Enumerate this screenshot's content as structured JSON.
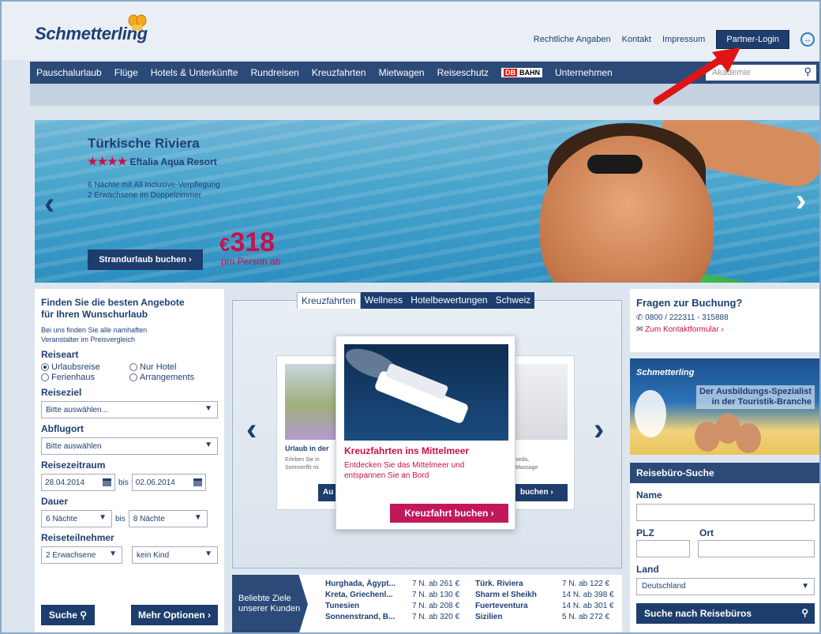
{
  "header": {
    "logo": "Schmetterling",
    "links": [
      "Rechtliche Angaben",
      "Kontakt",
      "Impressum"
    ],
    "partner_login": "Partner-Login"
  },
  "nav": {
    "items": [
      "Pauschalurlaub",
      "Flüge",
      "Hotels & Unterkünfte",
      "Rundreisen",
      "Kreuzfahrten",
      "Mietwagen",
      "Reiseschutz"
    ],
    "db_label": "DB",
    "bahn_label": "BAHN",
    "company": "Unternehmen",
    "search_placeholder": "Akademie"
  },
  "hero": {
    "title": "Türkische Riviera",
    "stars": "★★★★",
    "hotel": "Eftalia Aqua Resort",
    "desc_line1": "6 Nächte mit All Inclusive-Verpflegung",
    "desc_line2": "2 Erwachsene im Doppelzimmer",
    "button": "Strandurlaub buchen ›",
    "currency": "€",
    "price": "318",
    "per_person": "pro Person ab"
  },
  "search": {
    "title_line1": "Finden Sie die besten Angebote",
    "title_line2": "für Ihren Wunschurlaub",
    "sub_line1": "Bei uns finden Sie alle namhaften",
    "sub_line2": "Veranstalter im Preisvergleich",
    "reiseart_label": "Reiseart",
    "options": [
      "Urlaubsreise",
      "Nur Hotel",
      "Ferienhaus",
      "Arrangements"
    ],
    "reiseziel_label": "Reiseziel",
    "reiseziel_value": "Bitte auswählen...",
    "abflugort_label": "Abflugort",
    "abflugort_value": "Bitte auswählen",
    "zeitraum_label": "Reisezeitraum",
    "date_from": "28.04.2014",
    "bis": "bis",
    "date_to": "02.06.2014",
    "dauer_label": "Dauer",
    "dauer_from": "6 Nächte",
    "dauer_to": "8 Nächte",
    "teilnehmer_label": "Reiseteilnehmer",
    "adults": "2 Erwachsene",
    "kids": "kein Kind",
    "search_button": "Suche",
    "more_button": "Mehr Optionen ›"
  },
  "carousel": {
    "tabs": [
      "Kreuzfahrten",
      "Wellness",
      "Hotelbewertungen",
      "Schweiz"
    ],
    "left_card_title": "Urlaub in der",
    "left_card_desc1": "Erleben Sie in",
    "left_card_desc2": "Sommerflit mi",
    "left_card_btn": "Au",
    "right_card_desc1": "veda,",
    "right_card_desc2": "Massage",
    "right_card_btn": "buchen ›",
    "card_title": "Kreuzfahrten ins Mittelmeer",
    "card_desc": "Entdecken Sie das Mittelmeer und entspannen Sie an Bord",
    "card_button": "Kreuzfahrt buchen ›"
  },
  "destinations": {
    "head_line1": "Beliebte Ziele",
    "head_line2": "unserer Kunden",
    "rows": [
      [
        "Hurghada, Ägypt...",
        "7 N. ab 261 €",
        "Türk. Riviera",
        "7 N. ab 122 €"
      ],
      [
        "Kreta, Griechenl...",
        "7 N. ab 130 €",
        "Sharm el Sheikh",
        "14 N. ab 398 €"
      ],
      [
        "Tunesien",
        "7 N. ab 208 €",
        "Fuerteventura",
        "14 N. ab 301 €"
      ],
      [
        "Sonnenstrand, B...",
        "7 N. ab 320 €",
        "Sizilien",
        "5 N. ab 272 €"
      ]
    ]
  },
  "help": {
    "title": "Fragen zur Buchung?",
    "phone": "0800 / 222311 - 315888",
    "link": "Zum Kontaktformular ›"
  },
  "promo": {
    "logo": "Schmetterling",
    "text_line1": "Der Ausbildungs-Spezialist",
    "text_line2": "in der Touristik-Branche"
  },
  "reisebuero": {
    "title": "Reisebüro-Suche",
    "name_label": "Name",
    "plz_label": "PLZ",
    "ort_label": "Ort",
    "land_label": "Land",
    "land_value": "Deutschland",
    "button": "Suche nach Reisebüros"
  }
}
